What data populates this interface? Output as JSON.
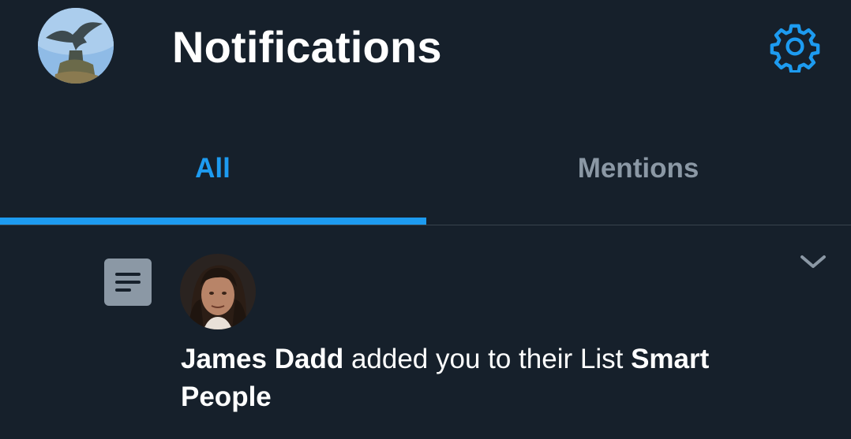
{
  "header": {
    "title": "Notifications",
    "avatar_icon": "user-avatar-statue",
    "settings_icon": "gear-icon"
  },
  "tabs": [
    {
      "label": "All",
      "active": true
    },
    {
      "label": "Mentions",
      "active": false
    }
  ],
  "notification": {
    "type_icon": "list-icon",
    "avatar_icon": "user-avatar-photo",
    "actor": "James Dadd",
    "action_text": " added you to their List ",
    "list_name": "Smart People",
    "more_icon": "chevron-down-icon"
  },
  "colors": {
    "background": "#16202b",
    "accent": "#1d9bf0",
    "inactive_text": "#8b98a5",
    "divider": "#38444d",
    "list_icon_bg": "#8b98a5"
  }
}
